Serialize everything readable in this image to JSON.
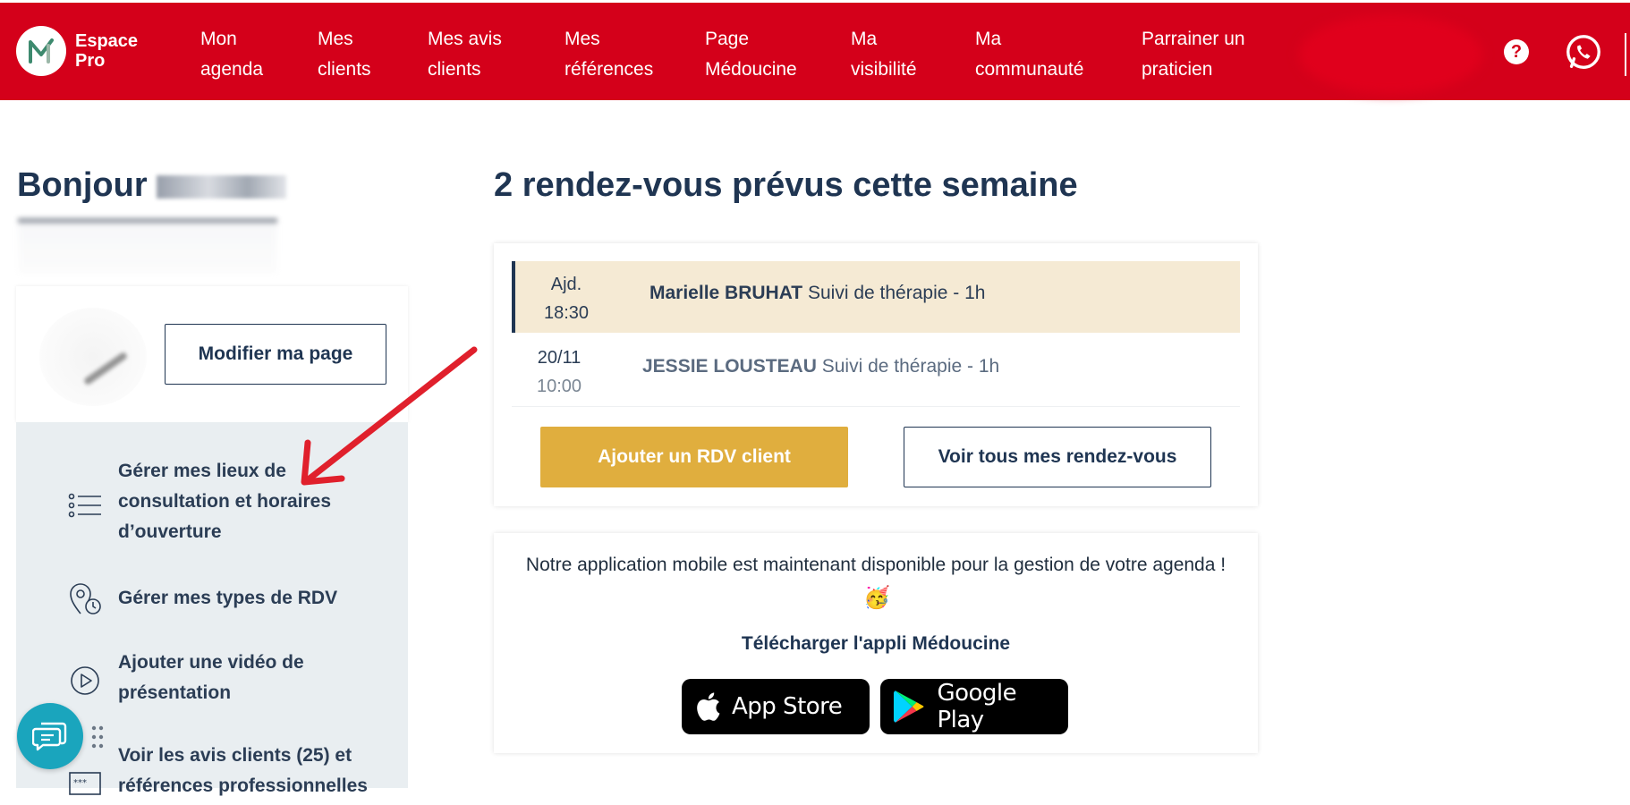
{
  "brand": {
    "name": "Espace Pro",
    "color": "#d4001a"
  },
  "nav": {
    "items": [
      {
        "label": "Mon\nagenda"
      },
      {
        "label": "Mes\nclients"
      },
      {
        "label": "Mes avis\nclients"
      },
      {
        "label": "Mes\nréférences"
      },
      {
        "label": "Page\nMédoucine"
      },
      {
        "label": "Ma\nvisibilité"
      },
      {
        "label": "Ma\ncommunauté"
      },
      {
        "label": "Parrainer un\npraticien"
      }
    ],
    "help_icon": "question-circle-icon",
    "help_symbol": "?",
    "whatsapp_icon": "whatsapp-icon"
  },
  "greeting": {
    "text": "Bonjour"
  },
  "profile": {
    "edit_button": "Modifier ma page"
  },
  "side_menu": [
    {
      "label": "Gérer mes lieux de consultation et horaires d’ouverture",
      "icon": "list-icon"
    },
    {
      "label": "Gérer mes types de RDV",
      "icon": "location-clock-icon"
    },
    {
      "label": "Ajouter une vidéo de présentation",
      "icon": "play-circle-icon"
    },
    {
      "label": "Voir les avis clients (25) et références professionnelles",
      "icon": "stars-icon"
    }
  ],
  "appointments": {
    "title": "2 rendez-vous prévus cette semaine",
    "rows": [
      {
        "day": "Ajd.",
        "time": "18:30",
        "client": "Marielle BRUHAT",
        "type": "Suivi de thérapie - 1h"
      },
      {
        "day": "20/11",
        "time": "10:00",
        "client": "JESSIE LOUSTEAU",
        "type": "Suivi de thérapie - 1h"
      }
    ],
    "add_button": "Ajouter un RDV client",
    "all_button": "Voir tous mes rendez-vous"
  },
  "mobile_app": {
    "message": "Notre application mobile est maintenant disponible pour la gestion de votre agenda !",
    "emoji": "🥳",
    "download_label": "Télécharger l'appli Médoucine",
    "app_store": "App Store",
    "google_play": "Google Play"
  },
  "colors": {
    "accent_yellow": "#e0ae3e",
    "navy": "#1f3552",
    "highlight_row": "#f5ead4",
    "chat": "#1aa5bd"
  }
}
